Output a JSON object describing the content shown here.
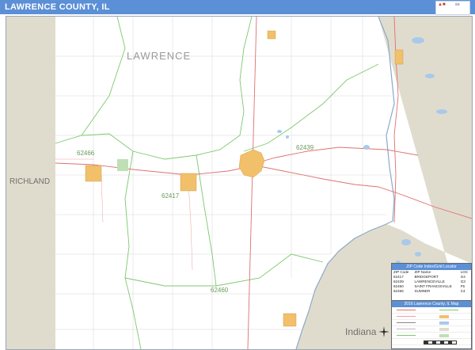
{
  "header": {
    "title": "LAWRENCE COUNTY, IL"
  },
  "map": {
    "county_label": "LAWRENCE",
    "neighbor_west": "RICHLAND",
    "neighbor_east": "Indiana",
    "zip_labels": [
      "62466",
      "62439",
      "62417",
      "62460"
    ],
    "colors": {
      "header": "#5b8fd6",
      "neighbor_fill": "#e0dccd",
      "zip_boundary": "#7ec86e",
      "highway": "#e07070",
      "city": "#f2c06a",
      "water": "#a9c9ea"
    }
  },
  "legend_zip": {
    "title": "ZIP Code Index/Grid Locator",
    "headers": [
      "ZIP Code",
      "ZIP Name",
      "LOC"
    ],
    "rows": [
      [
        "62417",
        "BRIDGEPORT",
        "G4"
      ],
      [
        "62439",
        "LAWRENCEVILLE",
        "G3"
      ],
      [
        "62460",
        "SAINT FRANCISVILLE",
        "F5"
      ],
      [
        "62466",
        "SUMNER",
        "C4"
      ]
    ]
  },
  "legend_map": {
    "title": "2016 Lawrence County, IL Map"
  }
}
